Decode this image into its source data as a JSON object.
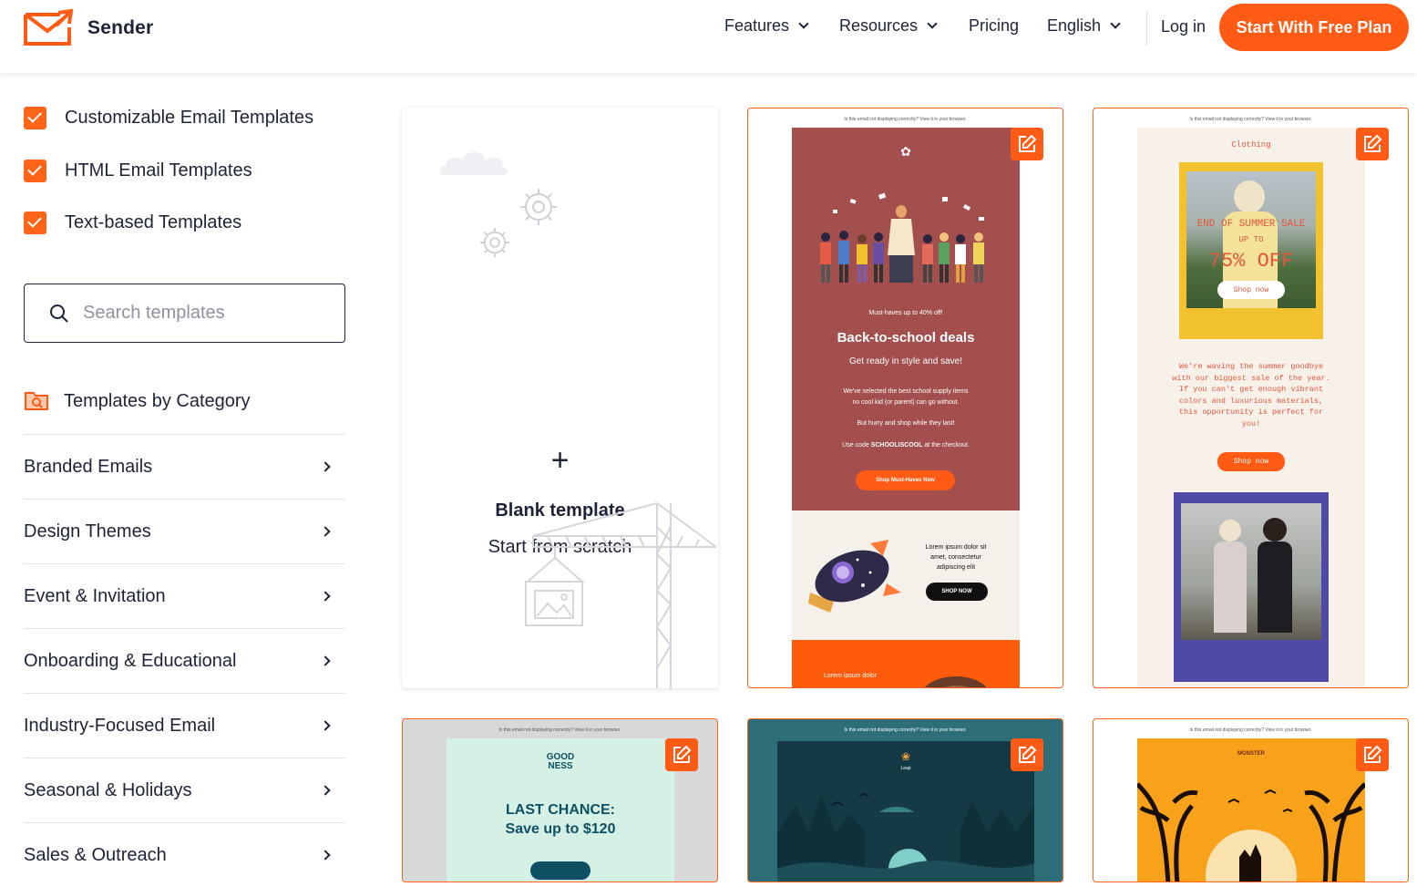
{
  "header": {
    "logo_text": "Sender",
    "nav": [
      "Features",
      "Resources",
      "Pricing",
      "English"
    ],
    "login": "Log in",
    "cta": "Start With Free Plan"
  },
  "colors": {
    "accent": "#ff5b14",
    "text": "#1e2437"
  },
  "filters": [
    {
      "label": "Customizable Email Templates",
      "checked": true
    },
    {
      "label": "HTML Email Templates",
      "checked": true
    },
    {
      "label": "Text-based Templates",
      "checked": true
    }
  ],
  "search": {
    "placeholder": "Search templates"
  },
  "categories": {
    "title": "Templates by Category",
    "items": [
      "Branded Emails",
      "Design Themes",
      "Event & Invitation",
      "Onboarding & Educational",
      "Industry-Focused Email",
      "Seasonal & Holidays",
      "Sales & Outreach"
    ]
  },
  "blank": {
    "title": "Blank template",
    "subtitle": "Start from scratch"
  },
  "templates": {
    "school": {
      "topline": "Is this email not displaying correctly? View it in your browser.",
      "small": "Must-haves up to 40% off!",
      "title": "Back-to-school deals",
      "sub": "Get ready in style and save!",
      "body1": "We've selected the best school supply items",
      "body1b": "no cool kid (or parent) can go without.",
      "body2": "But hurry and shop while they last!",
      "code_pre": "Use code ",
      "code": "SCHOOLISCOOL",
      "code_post": " at the checkout.",
      "button": "Shop Must-Haves Now",
      "lorem": "Lorem ipsum dolor sit amet, consectetur adipiscing elit",
      "lorem_btn": "SHOP NOW",
      "lorem2": "Lorem ipsum dolor"
    },
    "clothing": {
      "topline": "Is this email not displaying correctly? View it in your browser.",
      "brand": "Clothing",
      "sale1": "END OF SUMMER SALE",
      "sale2": "UP TO",
      "sale3": "75% OFF",
      "shop": "Shop now",
      "body": "We're waving the summer goodbye with our biggest sale of the year. If you can't get enough vibrant colors and luxurious materials, this opportunity is perfect for you!",
      "shop2": "Shop now"
    },
    "goodness": {
      "topline": "Is this email not displaying correctly? View it in your browser.",
      "logo1": "GOOD",
      "logo2": "NESS",
      "title": "LAST CHANCE:",
      "sub": "Save up to $120"
    },
    "leap": {
      "topline": "Is this email not displaying correctly? View it in your browser.",
      "logo": "Leap"
    },
    "halloween": {
      "topline": "Is this email not displaying correctly? View it in your browser.",
      "logo": "MONSTER"
    }
  }
}
